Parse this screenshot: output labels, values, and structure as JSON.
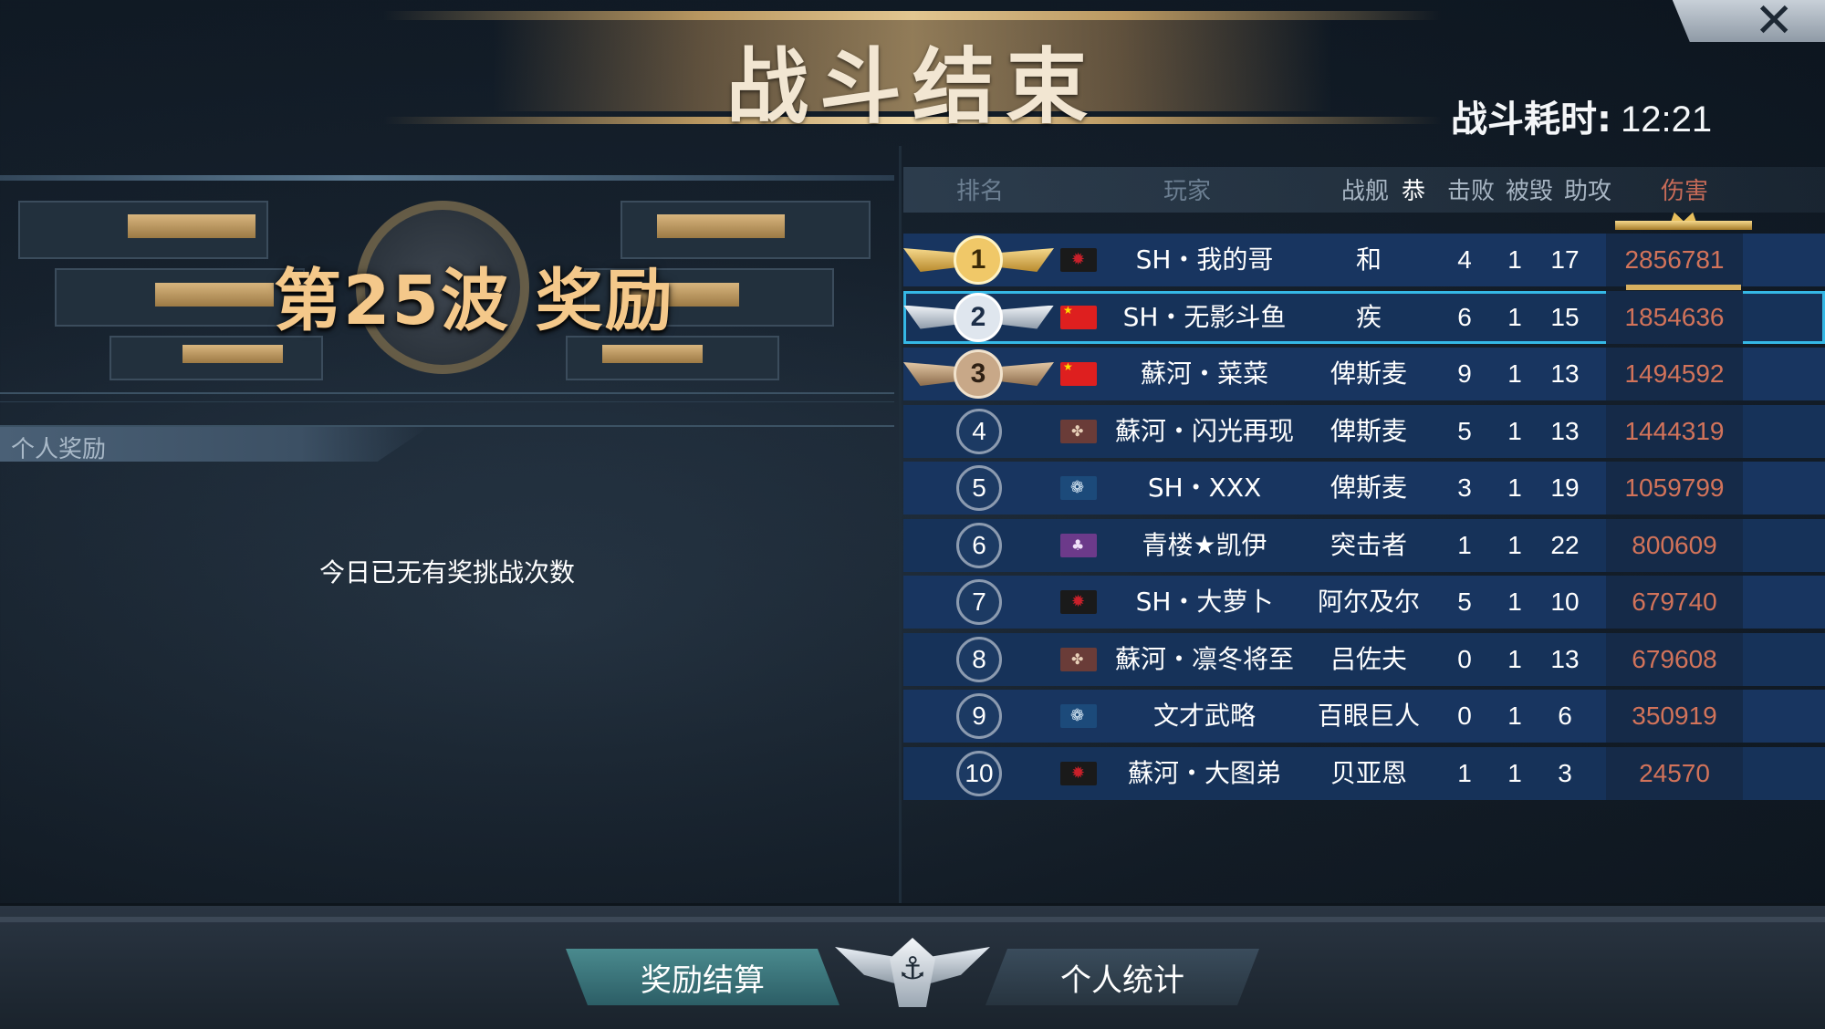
{
  "header": {
    "title": "战斗结束",
    "duration_label": "战斗耗时:",
    "duration_value": "12:21",
    "close_icon": "close-icon"
  },
  "left": {
    "wave_title": "第25波 奖励",
    "personal_tab": "个人奖励",
    "message": "今日已无有奖挑战次数"
  },
  "table": {
    "headers": {
      "rank": "排名",
      "player": "玩家",
      "ship": "战舰",
      "congrats": "恭",
      "kills": "击败",
      "deaths": "被毁",
      "assists": "助攻",
      "damage": "伤害"
    },
    "rows": [
      {
        "rank": "1",
        "flag": "dark",
        "player": "SH・我的哥",
        "ship": "和",
        "kills": "4",
        "deaths": "1",
        "assists": "17",
        "damage": "2856781"
      },
      {
        "rank": "2",
        "flag": "cn",
        "player": "SH・无影斗鱼",
        "ship": "疾",
        "kills": "6",
        "deaths": "1",
        "assists": "15",
        "damage": "1854636"
      },
      {
        "rank": "3",
        "flag": "cn",
        "player": "蘇河・菜菜",
        "ship": "俾斯麦",
        "kills": "9",
        "deaths": "1",
        "assists": "13",
        "damage": "1494592"
      },
      {
        "rank": "4",
        "flag": "brown",
        "player": "蘇河・闪光再现",
        "ship": "俾斯麦",
        "kills": "5",
        "deaths": "1",
        "assists": "13",
        "damage": "1444319"
      },
      {
        "rank": "5",
        "flag": "blue",
        "player": "SH・XXX",
        "ship": "俾斯麦",
        "kills": "3",
        "deaths": "1",
        "assists": "19",
        "damage": "1059799"
      },
      {
        "rank": "6",
        "flag": "purple",
        "player": "青楼★凯伊",
        "ship": "突击者",
        "kills": "1",
        "deaths": "1",
        "assists": "22",
        "damage": "800609"
      },
      {
        "rank": "7",
        "flag": "dark",
        "player": "SH・大萝卜",
        "ship": "阿尔及尔",
        "kills": "5",
        "deaths": "1",
        "assists": "10",
        "damage": "679740"
      },
      {
        "rank": "8",
        "flag": "brown",
        "player": "蘇河・凛冬将至",
        "ship": "吕佐夫",
        "kills": "0",
        "deaths": "1",
        "assists": "13",
        "damage": "679608"
      },
      {
        "rank": "9",
        "flag": "blue",
        "player": "文才武略",
        "ship": "百眼巨人",
        "kills": "0",
        "deaths": "1",
        "assists": "6",
        "damage": "350919"
      },
      {
        "rank": "10",
        "flag": "dark",
        "player": "蘇河・大图弟",
        "ship": "贝亚恩",
        "kills": "1",
        "deaths": "1",
        "assists": "3",
        "damage": "24570"
      }
    ],
    "highlighted_rank": "2"
  },
  "bottom": {
    "reward_tab": "奖励结算",
    "stats_tab": "个人统计"
  },
  "colors": {
    "row_bg": "#183560",
    "highlight": "#35b8e6",
    "damage_text": "#d2735a",
    "gold": "#f0c868"
  }
}
